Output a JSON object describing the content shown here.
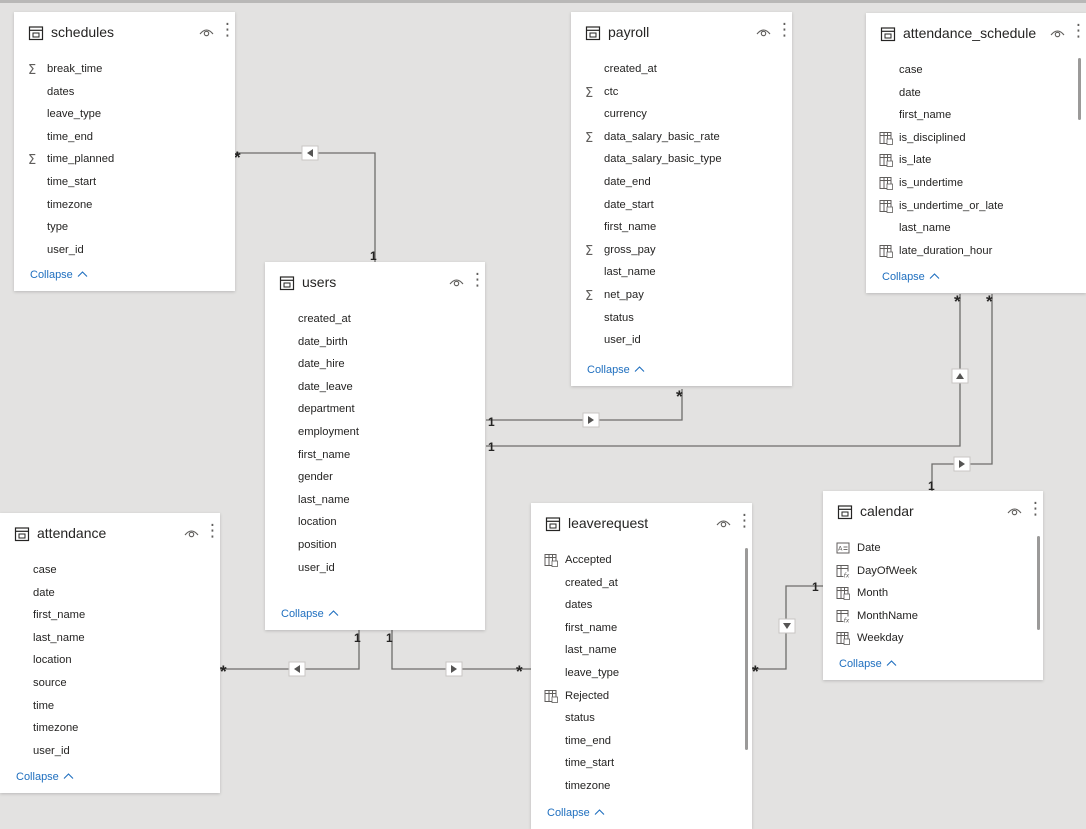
{
  "collapse_label": "Collapse",
  "tables": {
    "schedules": {
      "title": "schedules",
      "fields": [
        {
          "name": "break_time",
          "icon": "sigma-icon"
        },
        {
          "name": "dates",
          "icon": ""
        },
        {
          "name": "leave_type",
          "icon": ""
        },
        {
          "name": "time_end",
          "icon": ""
        },
        {
          "name": "time_planned",
          "icon": "sigma-icon"
        },
        {
          "name": "time_start",
          "icon": ""
        },
        {
          "name": "timezone",
          "icon": ""
        },
        {
          "name": "type",
          "icon": ""
        },
        {
          "name": "user_id",
          "icon": ""
        }
      ]
    },
    "payroll": {
      "title": "payroll",
      "fields": [
        {
          "name": "created_at",
          "icon": ""
        },
        {
          "name": "ctc",
          "icon": "sigma-icon"
        },
        {
          "name": "currency",
          "icon": ""
        },
        {
          "name": "data_salary_basic_rate",
          "icon": "sigma-icon"
        },
        {
          "name": "data_salary_basic_type",
          "icon": ""
        },
        {
          "name": "date_end",
          "icon": ""
        },
        {
          "name": "date_start",
          "icon": ""
        },
        {
          "name": "first_name",
          "icon": ""
        },
        {
          "name": "gross_pay",
          "icon": "sigma-icon"
        },
        {
          "name": "last_name",
          "icon": ""
        },
        {
          "name": "net_pay",
          "icon": "sigma-icon"
        },
        {
          "name": "status",
          "icon": ""
        },
        {
          "name": "user_id",
          "icon": ""
        }
      ]
    },
    "attendance_schedule": {
      "title": "attendance_schedule",
      "fields": [
        {
          "name": "case",
          "icon": ""
        },
        {
          "name": "date",
          "icon": ""
        },
        {
          "name": "first_name",
          "icon": ""
        },
        {
          "name": "is_disciplined",
          "icon": "calc-column-icon"
        },
        {
          "name": "is_late",
          "icon": "calc-column-icon"
        },
        {
          "name": "is_undertime",
          "icon": "calc-column-icon"
        },
        {
          "name": "is_undertime_or_late",
          "icon": "calc-column-icon"
        },
        {
          "name": "last_name",
          "icon": ""
        },
        {
          "name": "late_duration_hour",
          "icon": "calc-column-icon"
        }
      ]
    },
    "users": {
      "title": "users",
      "fields": [
        {
          "name": "created_at",
          "icon": ""
        },
        {
          "name": "date_birth",
          "icon": ""
        },
        {
          "name": "date_hire",
          "icon": ""
        },
        {
          "name": "date_leave",
          "icon": ""
        },
        {
          "name": "department",
          "icon": ""
        },
        {
          "name": "employment",
          "icon": ""
        },
        {
          "name": "first_name",
          "icon": ""
        },
        {
          "name": "gender",
          "icon": ""
        },
        {
          "name": "last_name",
          "icon": ""
        },
        {
          "name": "location",
          "icon": ""
        },
        {
          "name": "position",
          "icon": ""
        },
        {
          "name": "user_id",
          "icon": ""
        }
      ]
    },
    "attendance": {
      "title": "attendance",
      "fields": [
        {
          "name": "case",
          "icon": ""
        },
        {
          "name": "date",
          "icon": ""
        },
        {
          "name": "first_name",
          "icon": ""
        },
        {
          "name": "last_name",
          "icon": ""
        },
        {
          "name": "location",
          "icon": ""
        },
        {
          "name": "source",
          "icon": ""
        },
        {
          "name": "time",
          "icon": ""
        },
        {
          "name": "timezone",
          "icon": ""
        },
        {
          "name": "user_id",
          "icon": ""
        }
      ]
    },
    "leaverequest": {
      "title": "leaverequest",
      "fields": [
        {
          "name": "Accepted",
          "icon": "calc-column-icon"
        },
        {
          "name": "created_at",
          "icon": ""
        },
        {
          "name": "dates",
          "icon": ""
        },
        {
          "name": "first_name",
          "icon": ""
        },
        {
          "name": "last_name",
          "icon": ""
        },
        {
          "name": "leave_type",
          "icon": ""
        },
        {
          "name": "Rejected",
          "icon": "calc-column-icon"
        },
        {
          "name": "status",
          "icon": ""
        },
        {
          "name": "time_end",
          "icon": ""
        },
        {
          "name": "time_start",
          "icon": ""
        },
        {
          "name": "timezone",
          "icon": ""
        }
      ]
    },
    "calendar": {
      "title": "calendar",
      "fields": [
        {
          "name": "Date",
          "icon": "text-calc-icon"
        },
        {
          "name": "DayOfWeek",
          "icon": "calc-fx-icon"
        },
        {
          "name": "Month",
          "icon": "calc-column-icon"
        },
        {
          "name": "MonthName",
          "icon": "calc-fx-icon"
        },
        {
          "name": "Weekday",
          "icon": "calc-column-icon"
        }
      ]
    }
  },
  "cardinality": {
    "many": "*",
    "one": "1"
  }
}
